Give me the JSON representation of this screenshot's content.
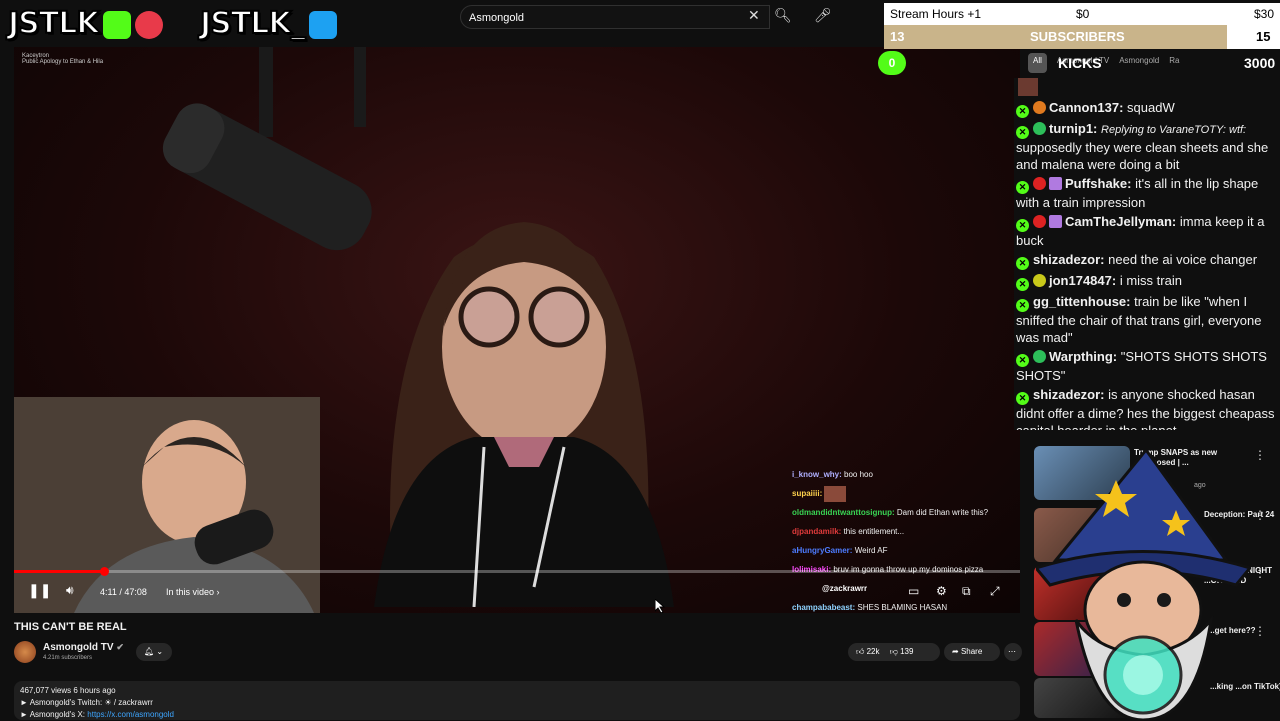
{
  "branding": {
    "left_name": "JSTLK",
    "right_name": "JSTLK_"
  },
  "search": {
    "value": "Asmongold"
  },
  "video": {
    "channel_top": "Kaceytron",
    "channel_top_sub": "Public Apology to Ethan & Hila",
    "progress_fraction": 0.089,
    "time": "4:11 / 47:08",
    "in_this_video": "In this video",
    "overlay_chat": [
      {
        "user": "i_know_why:",
        "text": "boo hoo",
        "color": "#b0b0ff"
      },
      {
        "user": "supaiiii:",
        "text": "",
        "color": "#ffd24d"
      },
      {
        "user": "oldmandidntwanttosignup:",
        "text": "Dam did Ethan write this?",
        "color": "#39d353"
      },
      {
        "user": "djpandamilk:",
        "text": "this entitlement...",
        "color": "#e03b3b"
      },
      {
        "user": "aHungryGamer:",
        "text": "Weird AF",
        "color": "#4d7cff"
      },
      {
        "user": "lolimisaki:",
        "text": "bruv im gonna throw up my dominos pizza",
        "color": "#ff4dff"
      },
      {
        "user": "@zackrawrr",
        "text": "",
        "color": "#ffffff"
      },
      {
        "user": "champababeast:",
        "text": "SHES BLAMING HASAN",
        "color": "#8fd3ff"
      }
    ]
  },
  "info": {
    "title": "THIS CAN'T BE REAL",
    "channel": "Asmongold TV",
    "subscribers": "4.21m subscribers",
    "likes": "22k",
    "dislikes": "139",
    "share": "Share",
    "views_line": "467,077 views  6 hours ago",
    "twitch_line": "► Asmongold's Twitch: ☀ / zackrawrr",
    "x_line_label": "► Asmongold's X:",
    "x_line_link": "https://x.com/asmongold"
  },
  "stream_overlay": {
    "hours_label": "Stream Hours +1",
    "hours_min": "$0",
    "hours_max": "$30",
    "subs_count": "13",
    "subs_label": "SUBSCRIBERS",
    "subs_goal": "15",
    "kicks_count": "0",
    "kicks_label": "KICKS",
    "kicks_goal": "3000",
    "chips": [
      "All",
      "Asmongold TV",
      "Asmongold",
      "Ra"
    ]
  },
  "chat": [
    {
      "user": "Cannon137:",
      "text": "squadW",
      "gem": "#e07a1f"
    },
    {
      "user": "turnip1:",
      "reply": "Replying to VaraneTOTY: wtf:",
      "text": "supposedly they were clean sheets and she and malena were doing a bit",
      "gem": "#2dbf5a"
    },
    {
      "user": "Puffshake:",
      "text": "it's all in the lip shape with a train impression",
      "gem": "#d22"
    },
    {
      "user": "CamTheJellyman:",
      "text": "imma keep it a buck",
      "gem": "#d22"
    },
    {
      "user": "shizadezor:",
      "text": "need the ai voice changer",
      "gem": ""
    },
    {
      "user": "jon174847:",
      "text": "i miss train",
      "gem": "#c9c91a"
    },
    {
      "user": "gg_tittenhouse:",
      "text": "train be like \"when I sniffed the chair of that trans girl, everyone was mad\"",
      "gem": ""
    },
    {
      "user": "Warpthing:",
      "text": "\"SHOTS SHOTS SHOTS SHOTS\"",
      "gem": "#2dbf5a"
    },
    {
      "user": "shizadezor:",
      "text": "is anyone shocked hasan didnt offer a dime? hes the biggest cheapass capital hoarder in the planet",
      "gem": ""
    }
  ],
  "recommendations": [
    {
      "title": "Trump SNAPS as new ... exposed | ...",
      "meta": "ago"
    },
    {
      "title": "Deception: Part 24",
      "meta": "ago"
    },
    {
      "title": "...ONNA TONIGHT ...ORGRND",
      "meta": ""
    },
    {
      "title": "...get here??",
      "meta": ""
    },
    {
      "title": "...king ...on TikTok)",
      "meta": ""
    }
  ],
  "colors": {
    "kick_green": "#53fc18",
    "subs_fill": "#c9b48a",
    "progress_red": "#ff0000"
  }
}
